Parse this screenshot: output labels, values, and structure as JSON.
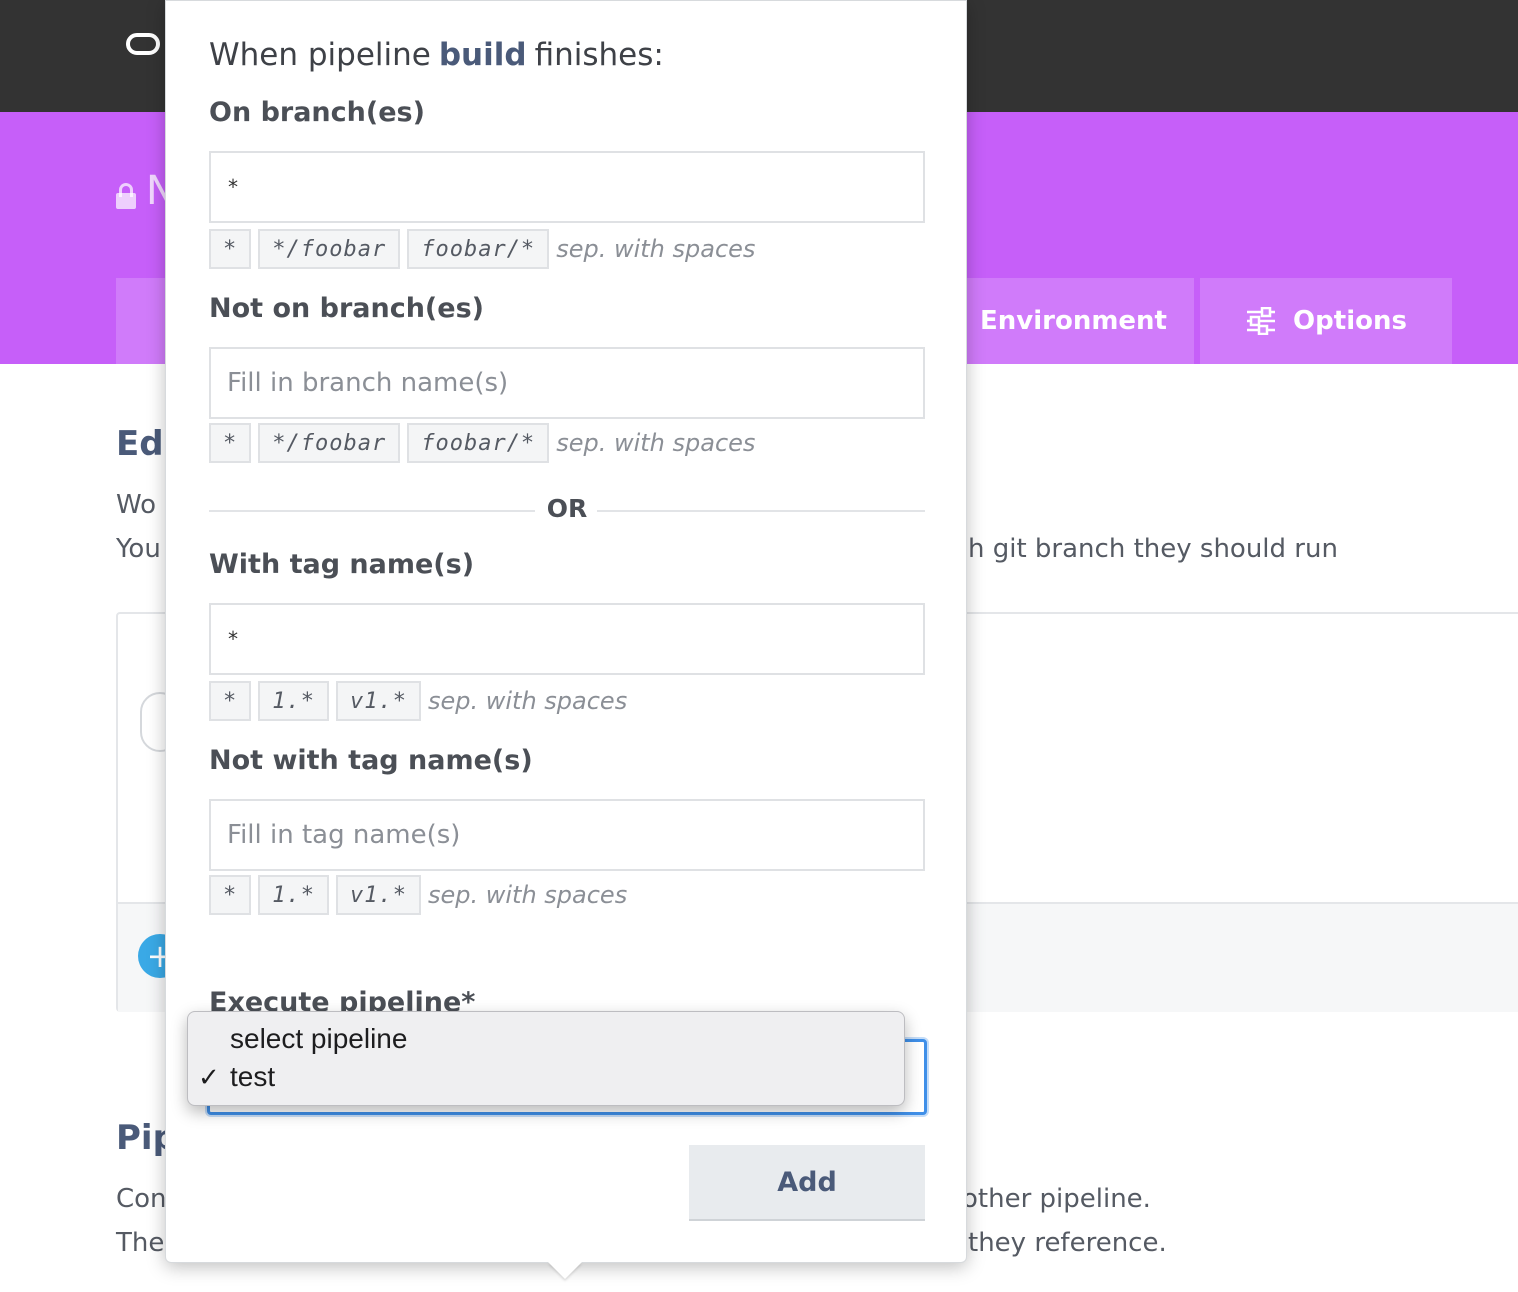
{
  "background": {
    "repo_name_partial": "N",
    "tabs": {
      "environment": "Environment",
      "options": "Options"
    },
    "sections": {
      "edit_heading_partial": "Edi",
      "edit_line1_partial": "Wo",
      "edit_line2_left_partial": "You",
      "edit_line2_right_partial": "h git branch they should run",
      "pipeline_heading_partial": "Pip",
      "pipeline_line1_left_partial": "Con",
      "pipeline_line1_right_partial": "other pipeline.",
      "pipeline_line2_left_partial": "The",
      "pipeline_line2_right_partial": "they reference."
    },
    "add_icon": "+"
  },
  "popover": {
    "title_prefix": "When pipeline",
    "pipeline_name": "build",
    "title_suffix": "finishes:",
    "on_branches": {
      "label": "On branch(es)",
      "value": "*",
      "placeholder": "",
      "examples": [
        "*",
        "*/foobar",
        "foobar/*"
      ],
      "hint": "sep. with spaces"
    },
    "not_on_branches": {
      "label": "Not on branch(es)",
      "value": "",
      "placeholder": "Fill in branch name(s)",
      "examples": [
        "*",
        "*/foobar",
        "foobar/*"
      ],
      "hint": "sep. with spaces"
    },
    "or_label": "OR",
    "with_tags": {
      "label": "With tag name(s)",
      "value": "*",
      "placeholder": "",
      "examples": [
        "*",
        "1.*",
        "v1.*"
      ],
      "hint": "sep. with spaces"
    },
    "not_with_tags": {
      "label": "Not with tag name(s)",
      "value": "",
      "placeholder": "Fill in tag name(s)",
      "examples": [
        "*",
        "1.*",
        "v1.*"
      ],
      "hint": "sep. with spaces"
    },
    "execute_pipeline": {
      "label": "Execute pipeline*",
      "options": [
        "select pipeline",
        "test"
      ],
      "selected": "test",
      "check_mark": "✓"
    },
    "add_button": "Add"
  },
  "colors": {
    "topbar": "#333333",
    "brand_purple": "#c65ff9",
    "heading_blue": "#4a5a79",
    "focus_blue": "#3f8fe8",
    "add_blue": "#3aa9e6"
  }
}
